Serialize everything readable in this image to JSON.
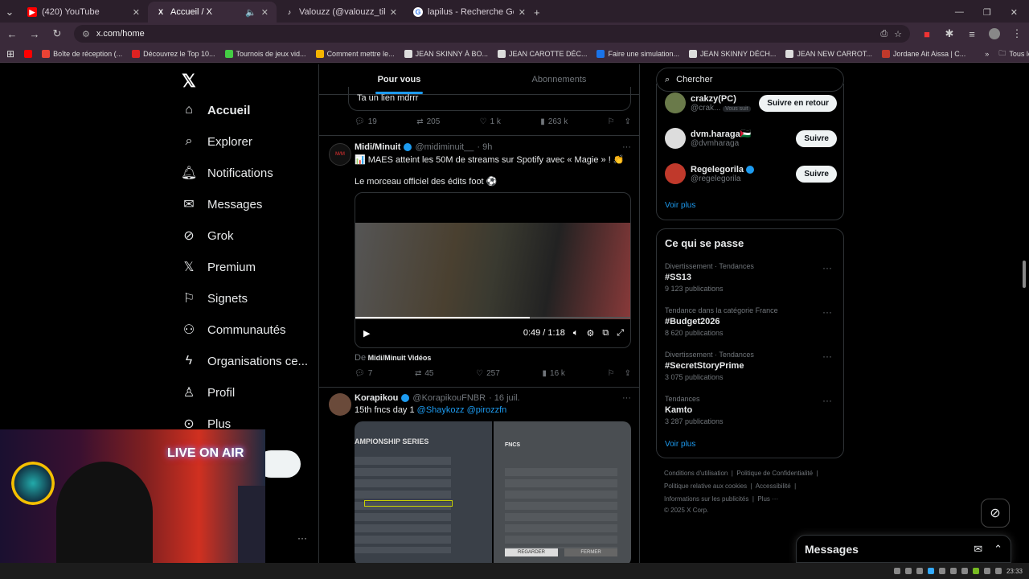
{
  "browser": {
    "tabs": [
      {
        "title": "(420) YouTube",
        "color": "#ff0000",
        "icon": "youtube-icon"
      },
      {
        "title": "Accueil / X",
        "color": "#000000",
        "icon": "x-icon"
      },
      {
        "title": "Valouzz (@valouzz_tiktok) | TikTok",
        "color": "#000000",
        "icon": "tiktok-icon"
      },
      {
        "title": "lapilus - Recherche Google",
        "color": "#4285f4",
        "icon": "google-icon"
      }
    ],
    "url": "x.com/home",
    "bookmarks": [
      "Boîte de réception (...",
      "Découvrez le Top 10...",
      "Tournois de jeux vid...",
      "Comment mettre le...",
      "JEAN SKINNY À BO...",
      "JEAN CAROTTE DÉC...",
      "Faire une simulation...",
      "JEAN SKINNY DÉCH...",
      "JEAN NEW CARROT...",
      "Jordane Ait Aissa | C..."
    ],
    "all_bookmarks": "Tous les favoris"
  },
  "nav": {
    "items": [
      "Accueil",
      "Explorer",
      "Notifications",
      "Messages",
      "Grok",
      "Premium",
      "Signets",
      "Communautés",
      "Organisations ce...",
      "Profil",
      "Plus"
    ]
  },
  "feed": {
    "tabs": [
      "Pour vous",
      "Abonnements"
    ],
    "prev": {
      "quote_text": "Ta un lien mdrrr",
      "replies": "19",
      "reposts": "205",
      "likes": "1 k",
      "views": "263 k"
    },
    "tweet1": {
      "name": "Midi/Minuit",
      "handle": "@midiminuit__",
      "time": "· 9h",
      "text1": "📊 MAES atteint les 50M de streams sur Spotify avec « Magie » ! 👏",
      "text2": "Le morceau officiel des édits foot ⚽",
      "video_time": "0:49 / 1:18",
      "video_progress": 0.63,
      "from_prefix": "De",
      "from_source": "Midi/Minuit Vidéos",
      "replies": "7",
      "reposts": "45",
      "likes": "257",
      "views": "16 k"
    },
    "tweet2": {
      "name": "Korapikou",
      "handle": "@KorapikouFNBR",
      "time": "· 16 juil.",
      "text_prefix": "15th fncs day 1",
      "mentions": "@Shaykozz @pirozzfn",
      "img1_title": "AMPIONSHIP SERIES",
      "img2_title": "FNCS",
      "img2_btn1": "REGARDER",
      "img2_btn2": "FERMER"
    }
  },
  "right": {
    "search_placeholder": "Chercher",
    "follows": [
      {
        "name": "crakzy(PC)",
        "handle": "@crak...",
        "badge": "Vous suit",
        "button": "Suivre en retour"
      },
      {
        "name": "dvm.haraga🇵🇸",
        "handle": "@dvmharaga",
        "button": "Suivre"
      },
      {
        "name": "Regelegorila",
        "handle": "@regelegorila",
        "button": "Suivre"
      }
    ],
    "see_more": "Voir plus",
    "trends_title": "Ce qui se passe",
    "trends": [
      {
        "category": "Divertissement · Tendances",
        "title": "#SS13",
        "posts": "9 123 publications"
      },
      {
        "category": "Tendance dans la catégorie France",
        "title": "#Budget2026",
        "posts": "8 620 publications"
      },
      {
        "category": "Divertissement · Tendances",
        "title": "#SecretStoryPrime",
        "posts": "3 075 publications"
      },
      {
        "category": "Tendances",
        "title": "Kamto",
        "posts": "3 287 publications"
      }
    ],
    "trends_more": "Voir plus",
    "footer": {
      "l1a": "Conditions d'utilisation",
      "l1b": "Politique de Confidentialité",
      "l2a": "Politique relative aux cookies",
      "l2b": "Accessibilité",
      "l3a": "Informations sur les publicités",
      "l3b": "Plus ···",
      "copy": "© 2025 X Corp."
    }
  },
  "messages_bar": "Messages",
  "webcam": {
    "sign": "LIVE ON AIR"
  },
  "clock": "23:33"
}
